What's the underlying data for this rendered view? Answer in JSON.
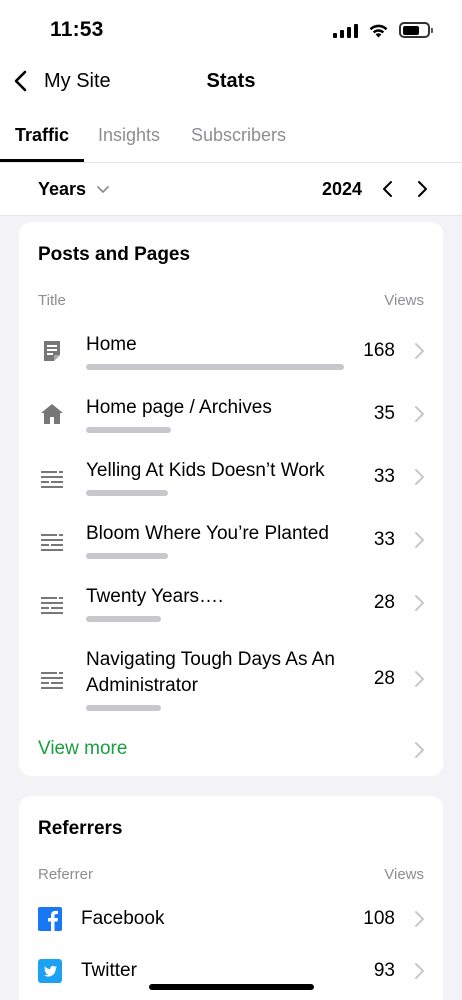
{
  "status_bar": {
    "time": "11:53"
  },
  "nav": {
    "back_label": "My Site",
    "title": "Stats"
  },
  "tabs": [
    {
      "label": "Traffic",
      "active": true
    },
    {
      "label": "Insights",
      "active": false
    },
    {
      "label": "Subscribers",
      "active": false
    }
  ],
  "period": {
    "selector": "Years",
    "year": "2024"
  },
  "posts_card": {
    "title": "Posts and Pages",
    "col_title": "Title",
    "col_views": "Views",
    "rows": [
      {
        "title": "Home",
        "views": "168",
        "icon": "page-icon"
      },
      {
        "title": "Home page / Archives",
        "views": "35",
        "icon": "home-icon"
      },
      {
        "title": "Yelling At Kids Doesn’t Work",
        "views": "33",
        "icon": "post-icon"
      },
      {
        "title": "Bloom Where You’re Planted",
        "views": "33",
        "icon": "post-icon"
      },
      {
        "title": "Twenty Years….",
        "views": "28",
        "icon": "post-icon"
      },
      {
        "title": "Navigating Tough Days As An Administrator",
        "views": "28",
        "icon": "post-icon"
      }
    ],
    "view_more": "View more"
  },
  "referrers_card": {
    "title": "Referrers",
    "col_referrer": "Referrer",
    "col_views": "Views",
    "rows": [
      {
        "name": "Facebook",
        "views": "108",
        "icon": "facebook-icon",
        "color": "#1877f2"
      },
      {
        "name": "Twitter",
        "views": "93",
        "icon": "twitter-icon",
        "color": "#1da1f2"
      }
    ]
  },
  "colors": {
    "accent_green": "#1a9e3f",
    "bar_gray": "#c7c7cc",
    "background": "#f2f2f7"
  }
}
